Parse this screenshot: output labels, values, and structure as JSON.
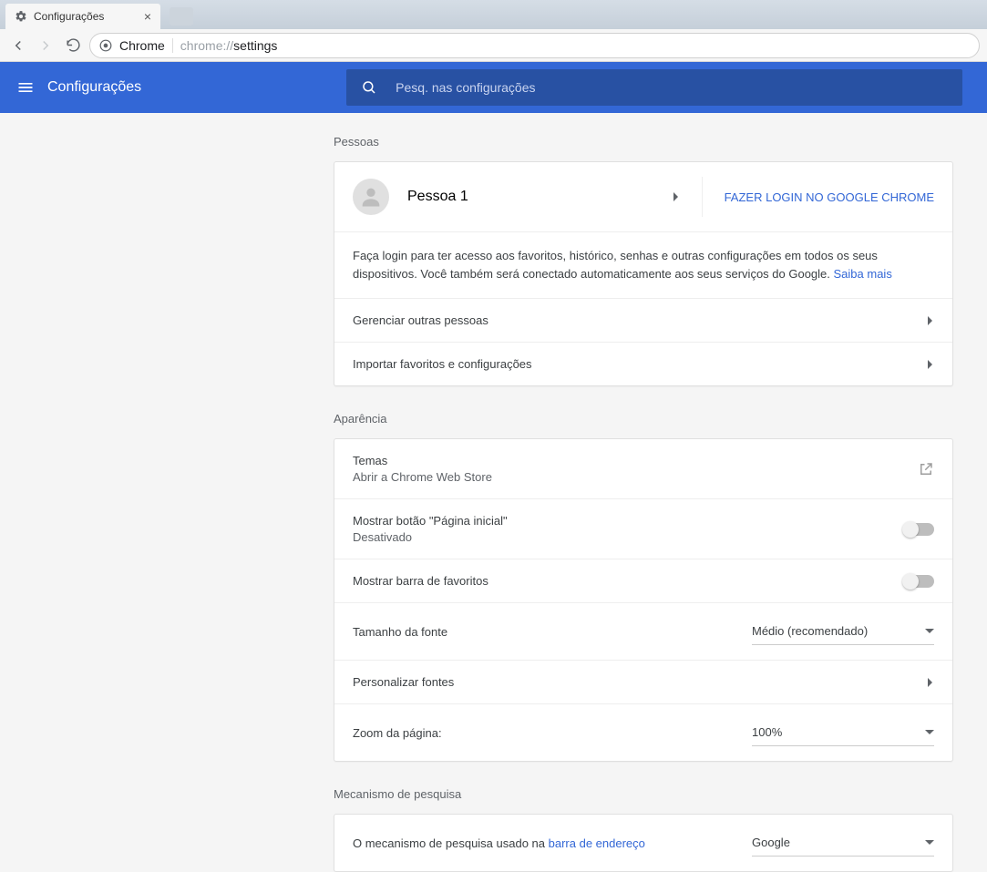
{
  "browser": {
    "tab_title": "Configurações",
    "omnibox_origin": "Chrome",
    "omnibox_path_dim": "chrome://",
    "omnibox_path": "settings"
  },
  "header": {
    "title": "Configurações",
    "search_placeholder": "Pesq. nas configurações"
  },
  "sections": {
    "people": {
      "title": "Pessoas",
      "profile_name": "Pessoa 1",
      "signin_cta": "FAZER LOGIN NO GOOGLE CHROME",
      "desc_text": "Faça login para ter acesso aos favoritos, histórico, senhas e outras configurações em todos os seus dispositivos. Você também será conectado automaticamente aos seus serviços do Google. ",
      "learn_more": "Saiba mais",
      "manage_people": "Gerenciar outras pessoas",
      "import": "Importar favoritos e configurações"
    },
    "appearance": {
      "title": "Aparência",
      "themes": "Temas",
      "themes_sub": "Abrir a Chrome Web Store",
      "show_home": "Mostrar botão \"Página inicial\"",
      "show_home_sub": "Desativado",
      "show_bookmarks_bar": "Mostrar barra de favoritos",
      "font_size": "Tamanho da fonte",
      "font_size_value": "Médio (recomendado)",
      "customize_fonts": "Personalizar fontes",
      "page_zoom": "Zoom da página:",
      "page_zoom_value": "100%"
    },
    "search": {
      "title": "Mecanismo de pesquisa",
      "engine_label_pre": "O mecanismo de pesquisa usado na ",
      "engine_label_link": "barra de endereço",
      "engine_value": "Google"
    }
  }
}
